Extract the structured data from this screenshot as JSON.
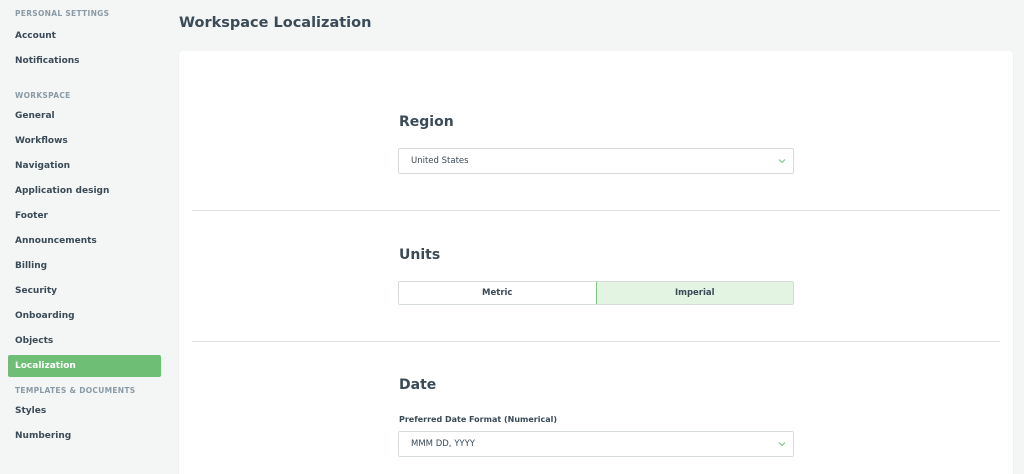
{
  "sidebar": {
    "sections": [
      {
        "label": "PERSONAL SETTINGS",
        "items": [
          {
            "label": "Account"
          },
          {
            "label": "Notifications"
          }
        ]
      },
      {
        "label": "WORKSPACE",
        "items": [
          {
            "label": "General"
          },
          {
            "label": "Workflows"
          },
          {
            "label": "Navigation"
          },
          {
            "label": "Application design"
          },
          {
            "label": "Footer"
          },
          {
            "label": "Announcements"
          },
          {
            "label": "Billing"
          },
          {
            "label": "Security"
          },
          {
            "label": "Onboarding"
          },
          {
            "label": "Objects"
          },
          {
            "label": "Localization",
            "active": true
          }
        ]
      },
      {
        "label": "TEMPLATES & DOCUMENTS",
        "items": [
          {
            "label": "Styles"
          },
          {
            "label": "Numbering"
          }
        ]
      }
    ]
  },
  "main": {
    "title": "Workspace Localization",
    "region": {
      "heading": "Region",
      "selected": "United States"
    },
    "units": {
      "heading": "Units",
      "options": [
        "Metric",
        "Imperial"
      ],
      "selected": "Imperial"
    },
    "date": {
      "heading": "Date",
      "field_label": "Preferred Date Format (Numerical)",
      "selected": "MMM DD, YYYY"
    }
  },
  "colors": {
    "accent": "#6fbe76",
    "selected_bg": "#e3f4e2",
    "text": "#3a4a57",
    "muted": "#8a9aa6"
  },
  "icons": {
    "dropdown": "chevron-down-icon"
  }
}
